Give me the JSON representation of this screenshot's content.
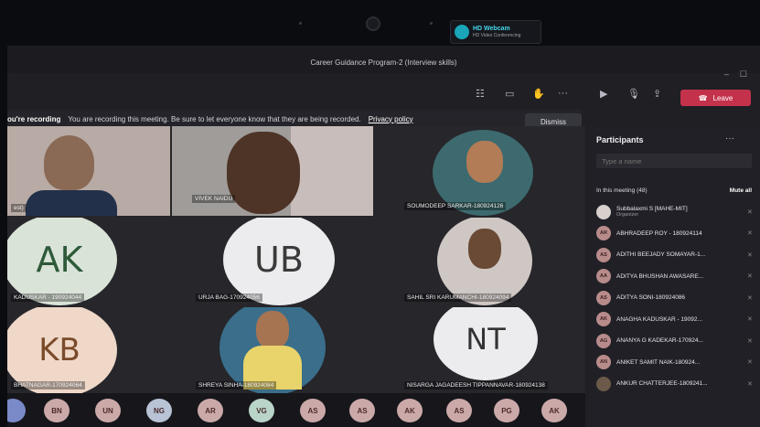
{
  "webcam": {
    "brand": "HD Webcam",
    "subtitle": "HD Video Conferencing"
  },
  "window": {
    "title": "Career Guidance Program-2 (Interview skills)"
  },
  "toolbar": {
    "leave_label": "Leave"
  },
  "banner": {
    "heading": "ou're recording",
    "message": "You are recording this meeting. Be sure to let everyone know that they are being recorded.",
    "link": "Privacy policy",
    "dismiss": "Dismiss"
  },
  "tiles": [
    {
      "label": "est)"
    },
    {
      "label": "VIVEK NAIDU"
    },
    {
      "label": "SOUMODEEP SARKAR-180924126"
    },
    {
      "initials": "AK",
      "label": "KADUSKAR - 190924044"
    },
    {
      "initials": "UB",
      "label": "URJA BAG-170924056"
    },
    {
      "label": "SAHIL SRI KARUMANCHI-180924094"
    },
    {
      "initials": "KB",
      "label": "BHATNAGAR-170924064"
    },
    {
      "label": "SHREYA SINHA-180924084"
    },
    {
      "initials": "NT",
      "label": "NISARGA JAGADEESH TIPPANNAVAR-180924138"
    }
  ],
  "participants": {
    "title": "Participants",
    "search_placeholder": "Type a name",
    "in_meeting": "In this meeting (48)",
    "mute_all": "Mute all",
    "items": [
      {
        "initials": "",
        "name": "Subbalaxmi S [MAHE-MIT]",
        "sub": "Organizer"
      },
      {
        "initials": "AR",
        "name": "ABHRADEEP ROY - 180924114",
        "sub": ""
      },
      {
        "initials": "AS",
        "name": "ADITHI BEEJADY SOMAYAR-1...",
        "sub": ""
      },
      {
        "initials": "AA",
        "name": "ADITYA BHUSHAN AWASARE...",
        "sub": ""
      },
      {
        "initials": "AS",
        "name": "ADITYA SONI-180924086",
        "sub": ""
      },
      {
        "initials": "AK",
        "name": "ANAGHA KADUSKAR - 19092...",
        "sub": ""
      },
      {
        "initials": "AG",
        "name": "ANANYA G KADEKAR-170924...",
        "sub": ""
      },
      {
        "initials": "AN",
        "name": "ANIKET SAMIT NAIK-180924...",
        "sub": ""
      },
      {
        "initials": "",
        "name": "ANKUR CHATTERJEE-1809241...",
        "sub": ""
      }
    ]
  },
  "bottom_avatars": [
    "BN",
    "UN",
    "NG",
    "AR",
    "VG",
    "AS",
    "AS",
    "AK",
    "AS",
    "PG",
    "AK"
  ]
}
